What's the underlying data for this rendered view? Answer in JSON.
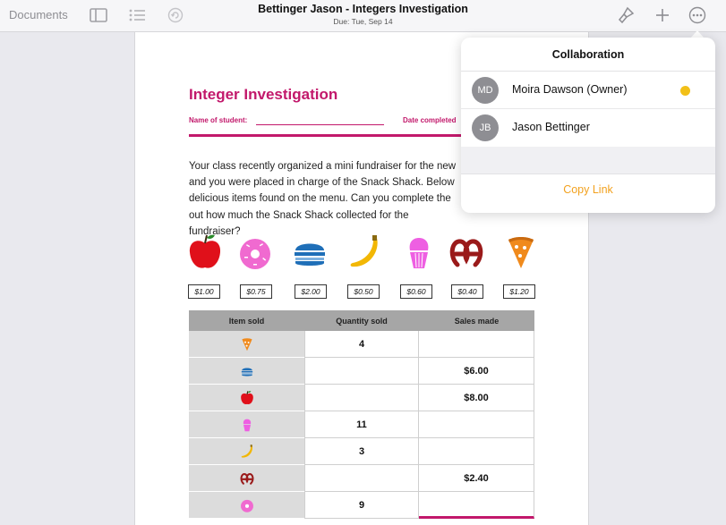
{
  "toolbar": {
    "documents_label": "Documents",
    "title": "Bettinger Jason - Integers Investigation",
    "subtitle": "Due: Tue, Sep 14",
    "icons": [
      "sidebar-icon",
      "list-icon",
      "undo-icon",
      "brush-icon",
      "plus-icon",
      "more-icon"
    ]
  },
  "document": {
    "title": "Integer Investigation",
    "name_label": "Name of student:",
    "date_label": "Date completed",
    "paragraph": "Your class recently organized a mini fundraiser for the new and you were placed in charge of the Snack Shack. Below delicious items found on the menu. Can you complete the out how much the Snack Shack collected for the fundraiser?",
    "items": [
      {
        "icon": "apple-icon",
        "price": "$1.00",
        "color": "#e0101a"
      },
      {
        "icon": "donut-icon",
        "price": "$0.75",
        "color": "#f06ad0"
      },
      {
        "icon": "burger-icon",
        "price": "$2.00",
        "color": "#1f6fb8"
      },
      {
        "icon": "banana-icon",
        "price": "$0.50",
        "color": "#f2b705"
      },
      {
        "icon": "cupcake-icon",
        "price": "$0.60",
        "color": "#ee5fe2"
      },
      {
        "icon": "pretzel-icon",
        "price": "$0.40",
        "color": "#9a1a1a"
      },
      {
        "icon": "pizza-icon",
        "price": "$1.20",
        "color": "#f08a1c"
      }
    ],
    "table": {
      "headers": [
        "Item sold",
        "Quantity sold",
        "Sales made"
      ],
      "rows": [
        {
          "icon": "pizza-icon",
          "quantity": "4",
          "sales": ""
        },
        {
          "icon": "burger-icon",
          "quantity": "",
          "sales": "$6.00"
        },
        {
          "icon": "apple-icon",
          "quantity": "",
          "sales": "$8.00"
        },
        {
          "icon": "cupcake-icon",
          "quantity": "11",
          "sales": ""
        },
        {
          "icon": "banana-icon",
          "quantity": "3",
          "sales": ""
        },
        {
          "icon": "pretzel-icon",
          "quantity": "",
          "sales": "$2.40"
        },
        {
          "icon": "donut-icon",
          "quantity": "9",
          "sales": ""
        }
      ]
    }
  },
  "collaboration": {
    "title": "Collaboration",
    "people": [
      {
        "initials": "MD",
        "name": "Moira Dawson (Owner)",
        "status_color": "#f2c018"
      },
      {
        "initials": "JB",
        "name": "Jason Bettinger",
        "status_color": ""
      }
    ],
    "copy_link_label": "Copy Link",
    "accent": "#f2a11e"
  }
}
